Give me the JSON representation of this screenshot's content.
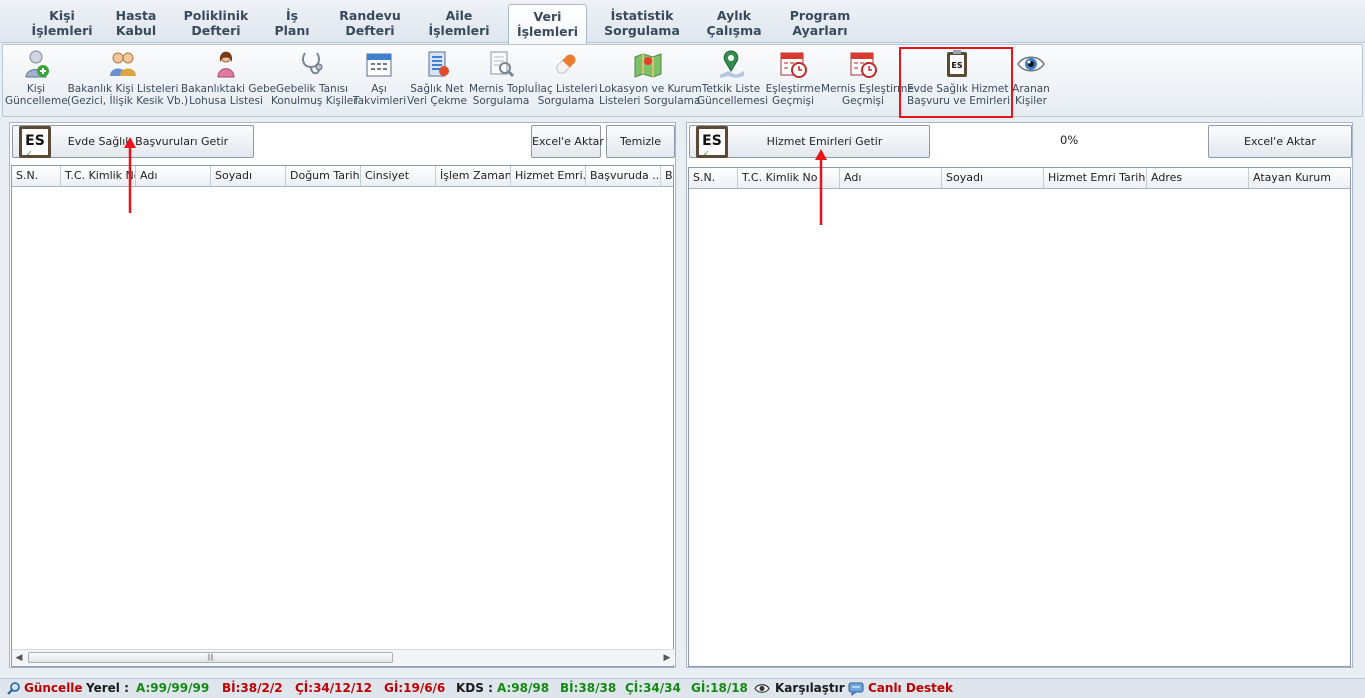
{
  "tabs": [
    {
      "line1": "Kişi",
      "line2": "İşlemleri"
    },
    {
      "line1": "Hasta",
      "line2": "Kabul"
    },
    {
      "line1": "Poliklinik",
      "line2": "Defteri"
    },
    {
      "line1": "İş",
      "line2": "Planı"
    },
    {
      "line1": "Randevu",
      "line2": "Defteri"
    },
    {
      "line1": "Aile",
      "line2": "İşlemleri"
    },
    {
      "line1": "Veri",
      "line2": "İşlemleri"
    },
    {
      "line1": "İstatistik",
      "line2": "Sorgulama"
    },
    {
      "line1": "Aylık",
      "line2": "Çalışma"
    },
    {
      "line1": "Program",
      "line2": "Ayarları"
    }
  ],
  "active_tab": "Veri İşlemleri",
  "ribbon": [
    {
      "line1": "Kişi",
      "line2": "Güncelleme",
      "icon": "person-sync-icon"
    },
    {
      "line1": "Bakanlık Kişi Listeleri",
      "line2": "(Gezici, İlişik Kesik Vb.)",
      "icon": "people-icon"
    },
    {
      "line1": "Bakanlıktaki Gebe",
      "line2": "Lohusa Listesi",
      "icon": "pregnant-woman-icon"
    },
    {
      "line1": "Gebelik Tanısı",
      "line2": "Konulmuş Kişiler",
      "icon": "stethoscope-icon"
    },
    {
      "line1": "Aşı",
      "line2": "Takvimleri",
      "icon": "calendar-icon"
    },
    {
      "line1": "Sağlık Net",
      "line2": "Veri Çekme",
      "icon": "database-icon"
    },
    {
      "line1": "Mernis Toplu",
      "line2": "Sorgulama",
      "icon": "document-search-icon"
    },
    {
      "line1": "İlaç Listeleri",
      "line2": "Sorgulama",
      "icon": "pill-icon"
    },
    {
      "line1": "Lokasyon ve Kurum",
      "line2": "Listeleri Sorgulama",
      "icon": "map-icon"
    },
    {
      "line1": "Tetkik Liste",
      "line2": "Güncellemesi",
      "icon": "map-pin-icon"
    },
    {
      "line1": "Eşleştirme",
      "line2": "Geçmişi",
      "icon": "calendar-clock-icon"
    },
    {
      "line1": "Mernis Eşleştirme",
      "line2": "Geçmişi",
      "icon": "calendar-clock-icon"
    },
    {
      "line1": "Evde Sağlık Hizmet",
      "line2": "Başvuru ve Emirleri",
      "icon": "es-clipboard-icon"
    },
    {
      "line1": "Aranan",
      "line2": "Kişiler",
      "icon": "eye-icon"
    }
  ],
  "left": {
    "fetch_button": "Evde Sağlık Başvuruları Getir",
    "es_icon_text": "ES",
    "export_button": "Excel'e Aktar",
    "clear_button": "Temizle",
    "columns": [
      "S.N.",
      "T.C. Kimlik No",
      "Adı",
      "Soyadı",
      "Doğum Tarihi",
      "Cinsiyet",
      "İşlem Zamanı",
      "Hizmet Emri...",
      "Başvuruda ...",
      "Ba"
    ]
  },
  "right": {
    "fetch_button": "Hizmet Emirleri Getir",
    "es_icon_text": "ES",
    "progress": "0%",
    "export_button": "Excel'e Aktar",
    "columns": [
      "S.N.",
      "T.C. Kimlik No",
      "Adı",
      "Soyadı",
      "Hizmet Emri Tarihi",
      "Adres",
      "Atayan Kurum"
    ]
  },
  "status": {
    "update": "Güncelle",
    "local_label": "Yerel :",
    "local_a": "A:99/99/99",
    "local_bi": "Bİ:38/2/2",
    "local_ci": "Çİ:34/12/12",
    "local_gi": "Gİ:19/6/6",
    "kds_label": "KDS :",
    "kds_a": "A:98/98",
    "kds_bi": "Bİ:38/38",
    "kds_ci": "Çİ:34/34",
    "kds_gi": "Gİ:18/18",
    "compare": "Karşılaştır",
    "support": "Canlı Destek"
  }
}
